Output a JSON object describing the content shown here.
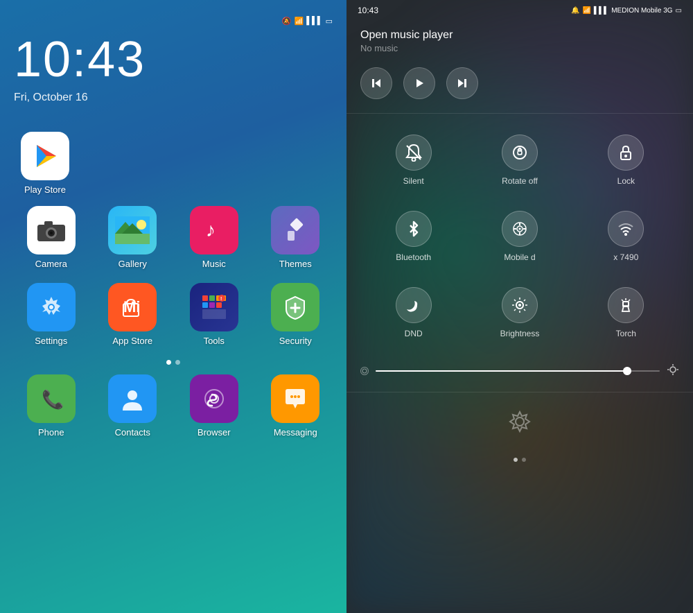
{
  "left": {
    "status": {
      "icons": [
        "🔔",
        "📶",
        "📶",
        "🔋"
      ]
    },
    "time": "10:43",
    "date": "Fri, October 16",
    "apps_row1": [
      {
        "id": "play-store",
        "label": "Play Store",
        "bg": "#ffffff",
        "type": "play-store"
      }
    ],
    "apps_row2": [
      {
        "id": "camera",
        "label": "Camera",
        "bg": "#ffffff",
        "type": "camera"
      },
      {
        "id": "gallery",
        "label": "Gallery",
        "bg": "gallery",
        "type": "gallery"
      },
      {
        "id": "music",
        "label": "Music",
        "bg": "#e91e63",
        "type": "music"
      },
      {
        "id": "themes",
        "label": "Themes",
        "bg": "themes",
        "type": "themes"
      }
    ],
    "apps_row3": [
      {
        "id": "settings",
        "label": "Settings",
        "bg": "#2196F3",
        "type": "settings"
      },
      {
        "id": "appstore",
        "label": "App Store",
        "bg": "#ff5722",
        "type": "appstore"
      },
      {
        "id": "tools",
        "label": "Tools",
        "bg": "tools",
        "type": "tools"
      },
      {
        "id": "security",
        "label": "Security",
        "bg": "#4CAF50",
        "type": "security"
      }
    ],
    "dots": [
      true,
      false
    ],
    "apps_bottom": [
      {
        "id": "phone",
        "label": "Phone",
        "bg": "#4CAF50",
        "type": "phone"
      },
      {
        "id": "contacts",
        "label": "Contacts",
        "bg": "#2196F3",
        "type": "contacts"
      },
      {
        "id": "browser",
        "label": "Browser",
        "bg": "#7B1FA2",
        "type": "browser"
      },
      {
        "id": "messaging",
        "label": "Messaging",
        "bg": "#FF9800",
        "type": "messaging"
      }
    ]
  },
  "right": {
    "status": {
      "time": "10:43",
      "network": "MEDION Mobile 3G",
      "battery": "🔋"
    },
    "music": {
      "title": "Open music player",
      "subtitle": "No music",
      "prev_label": "⏮",
      "play_label": "▶",
      "next_label": "⏭"
    },
    "quick_settings": [
      {
        "id": "silent",
        "label": "Silent",
        "icon": "silent"
      },
      {
        "id": "rotate",
        "label": "Rotate off",
        "icon": "rotate"
      },
      {
        "id": "lock",
        "label": "Lock",
        "icon": "lock"
      },
      {
        "id": "bluetooth",
        "label": "Bluetooth",
        "icon": "bluetooth"
      },
      {
        "id": "mobile",
        "label": "Mobile d",
        "icon": "mobile"
      },
      {
        "id": "wifi",
        "label": "x 7490",
        "icon": "wifi"
      },
      {
        "id": "dnd",
        "label": "DND",
        "icon": "dnd"
      },
      {
        "id": "brightness",
        "label": "Brightness",
        "icon": "brightness"
      },
      {
        "id": "torch",
        "label": "Torch",
        "icon": "torch"
      }
    ],
    "brightness_value": 90,
    "bottom_dots": [
      true,
      false
    ]
  }
}
